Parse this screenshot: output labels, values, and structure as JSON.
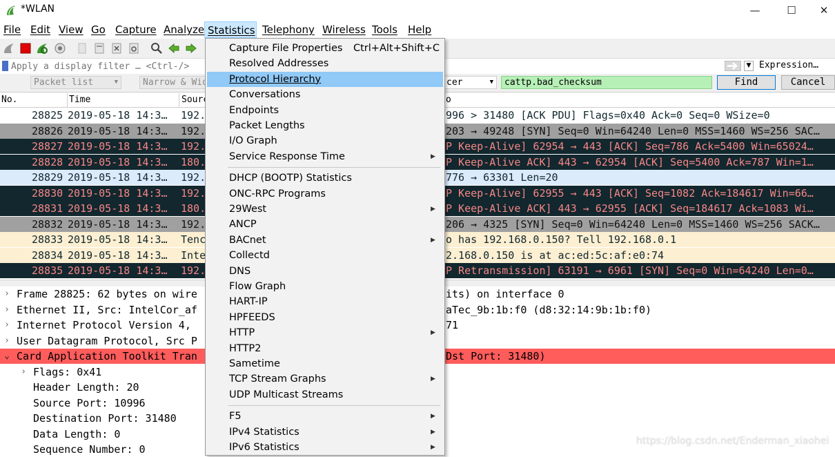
{
  "window": {
    "title": "*WLAN",
    "minimize": "—",
    "maximize": "☐",
    "close": "✕"
  },
  "menubar": [
    "File",
    "Edit",
    "View",
    "Go",
    "Capture",
    "Analyze",
    "Statistics",
    "Telephony",
    "Wireless",
    "Tools",
    "Help"
  ],
  "filter": {
    "placeholder": "Apply a display filter … <Ctrl-/>",
    "expression_label": "Expression…"
  },
  "findbar": {
    "combo1": "Packet list",
    "combo2": "Narrow & Wide",
    "combo3": "cer",
    "find_value": "cattp.bad_checksum",
    "find_button": "Find",
    "cancel_button": "Cancel"
  },
  "columns": [
    "No.",
    "Time",
    "Source",
    "o"
  ],
  "packets": [
    {
      "no": "28825",
      "time": "2019-05-18 14:3…",
      "src": "192.",
      "info": "996 > 31480 [ACK PDU] Flags=0x40 Ack=0 Seq=0 WSize=0",
      "style": "sel"
    },
    {
      "no": "28826",
      "time": "2019-05-18 14:3…",
      "src": "192.",
      "info": "203 → 49248 [SYN] Seq=0 Win=64240 Len=0 MSS=1460 WS=256 SAC…",
      "style": "gray"
    },
    {
      "no": "28827",
      "time": "2019-05-18 14:3…",
      "src": "192.",
      "info": "P Keep-Alive] 62954 → 443 [ACK] Seq=786 Ack=5400 Win=65024…",
      "style": "dark"
    },
    {
      "no": "28828",
      "time": "2019-05-18 14:3…",
      "src": "180.",
      "info": "P Keep-Alive ACK] 443 → 62954 [ACK] Seq=5400 Ack=787 Win=1…",
      "style": "dark"
    },
    {
      "no": "28829",
      "time": "2019-05-18 14:3…",
      "src": "192.",
      "info": "776 → 63301 Len=20",
      "style": "lblue"
    },
    {
      "no": "28830",
      "time": "2019-05-18 14:3…",
      "src": "192.",
      "info": "P Keep-Alive] 62955 → 443 [ACK] Seq=1082 Ack=184617 Win=66…",
      "style": "dark"
    },
    {
      "no": "28831",
      "time": "2019-05-18 14:3…",
      "src": "180.",
      "info": "P Keep-Alive ACK] 443 → 62955 [ACK] Seq=184617 Ack=1083 Wi…",
      "style": "dark"
    },
    {
      "no": "28832",
      "time": "2019-05-18 14:3…",
      "src": "192.",
      "info": "206 → 4325 [SYN] Seq=0 Win=64240 Len=0 MSS=1460 WS=256 SACK…",
      "style": "gray"
    },
    {
      "no": "28833",
      "time": "2019-05-18 14:3…",
      "src": "Tenc",
      "info": "o has 192.168.0.150? Tell 192.168.0.1",
      "style": "cream"
    },
    {
      "no": "28834",
      "time": "2019-05-18 14:3…",
      "src": "Inte",
      "info": "2.168.0.150 is at ac:ed:5c:af:e0:74",
      "style": "cream"
    },
    {
      "no": "28835",
      "time": "2019-05-18 14:3…",
      "src": "192.",
      "info": "P Retransmission] 63191 → 6961 [SYN] Seq=0 Win=64240 Len=0…",
      "style": "dark"
    }
  ],
  "details": [
    {
      "arrow": ">",
      "indent": 0,
      "text": "Frame 28825: 62 bytes on wire",
      "text2": "its) on interface 0",
      "hl": false
    },
    {
      "arrow": ">",
      "indent": 0,
      "text": "Ethernet II, Src: IntelCor_af",
      "text2": "aTec_9b:1b:f0 (d8:32:14:9b:1b:f0)",
      "hl": false
    },
    {
      "arrow": ">",
      "indent": 0,
      "text": "Internet Protocol Version 4,",
      "text2": "71",
      "hl": false
    },
    {
      "arrow": ">",
      "indent": 0,
      "text": "User Datagram Protocol, Src P",
      "text2": "",
      "hl": false
    },
    {
      "arrow": "v",
      "indent": 0,
      "text": "Card Application Toolkit Tran",
      "text2": "Dst Port: 31480)",
      "hl": true
    },
    {
      "arrow": ">",
      "indent": 1,
      "text": "Flags: 0x41",
      "text2": "",
      "hl": false
    },
    {
      "arrow": "",
      "indent": 1,
      "text": "Header Length: 20",
      "text2": "",
      "hl": false
    },
    {
      "arrow": "",
      "indent": 1,
      "text": "Source Port: 10996",
      "text2": "",
      "hl": false
    },
    {
      "arrow": "",
      "indent": 1,
      "text": "Destination Port: 31480",
      "text2": "",
      "hl": false
    },
    {
      "arrow": "",
      "indent": 1,
      "text": "Data Length: 0",
      "text2": "",
      "hl": false
    },
    {
      "arrow": "",
      "indent": 1,
      "text": "Sequence Number: 0",
      "text2": "",
      "hl": false
    }
  ],
  "stats_menu": [
    {
      "label": "Capture File Properties",
      "shortcut": "Ctrl+Alt+Shift+C"
    },
    {
      "label": "Resolved Addresses"
    },
    {
      "label": "Protocol Hierarchy",
      "active": true
    },
    {
      "label": "Conversations"
    },
    {
      "label": "Endpoints"
    },
    {
      "label": "Packet Lengths"
    },
    {
      "label": "I/O Graph"
    },
    {
      "label": "Service Response Time",
      "submenu": true
    },
    {
      "sep": true
    },
    {
      "label": "DHCP (BOOTP) Statistics"
    },
    {
      "label": "ONC-RPC Programs"
    },
    {
      "label": "29West",
      "submenu": true
    },
    {
      "label": "ANCP"
    },
    {
      "label": "BACnet",
      "submenu": true
    },
    {
      "label": "Collectd"
    },
    {
      "label": "DNS"
    },
    {
      "label": "Flow Graph"
    },
    {
      "label": "HART-IP"
    },
    {
      "label": "HPFEEDS"
    },
    {
      "label": "HTTP",
      "submenu": true
    },
    {
      "label": "HTTP2"
    },
    {
      "label": "Sametime"
    },
    {
      "label": "TCP Stream Graphs",
      "submenu": true
    },
    {
      "label": "UDP Multicast Streams"
    },
    {
      "sep": true
    },
    {
      "label": "F5",
      "submenu": true
    },
    {
      "label": "IPv4 Statistics",
      "submenu": true
    },
    {
      "label": "IPv6 Statistics",
      "submenu": true
    }
  ],
  "watermark": "https://blog.csdn.net/Enderman_xiaohei",
  "colors": {
    "dark_row": "#12272e",
    "dark_row_text": "#f78787",
    "highlight_row": "#ff5c5c",
    "menu_active": "#91c9f7",
    "find_green": "#b7f0b7"
  }
}
